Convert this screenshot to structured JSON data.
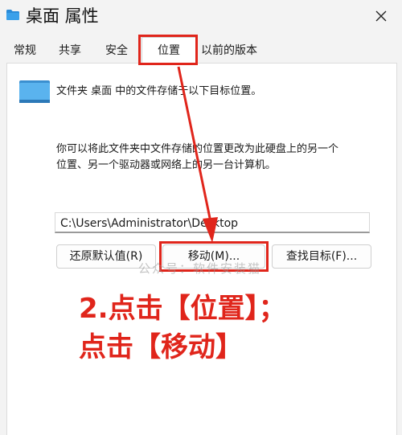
{
  "window": {
    "title": "桌面 属性",
    "close_icon": "close-icon"
  },
  "tabs": [
    {
      "label": "常规"
    },
    {
      "label": "共享"
    },
    {
      "label": "安全"
    },
    {
      "label": "位置",
      "active": true
    },
    {
      "label": "以前的版本"
    }
  ],
  "location": {
    "intro": "文件夹 桌面 中的文件存储于以下目标位置。",
    "description_line1": "你可以将此文件夹中文件存储的位置更改为此硬盘上的另一个",
    "description_line2": "位置、另一个驱动器或网络上的另一台计算机。",
    "path_value": "C:\\Users\\Administrator\\Desktop"
  },
  "buttons": {
    "restore_default": "还原默认值(R)",
    "move": "移动(M)...",
    "find_target": "查找目标(F)..."
  },
  "overlay": {
    "watermark": "公众号：软件安装猫",
    "annotation_line1": "2.点击【位置】；",
    "annotation_line2": "点击【移动】",
    "highlight_color": "#e0251b"
  }
}
